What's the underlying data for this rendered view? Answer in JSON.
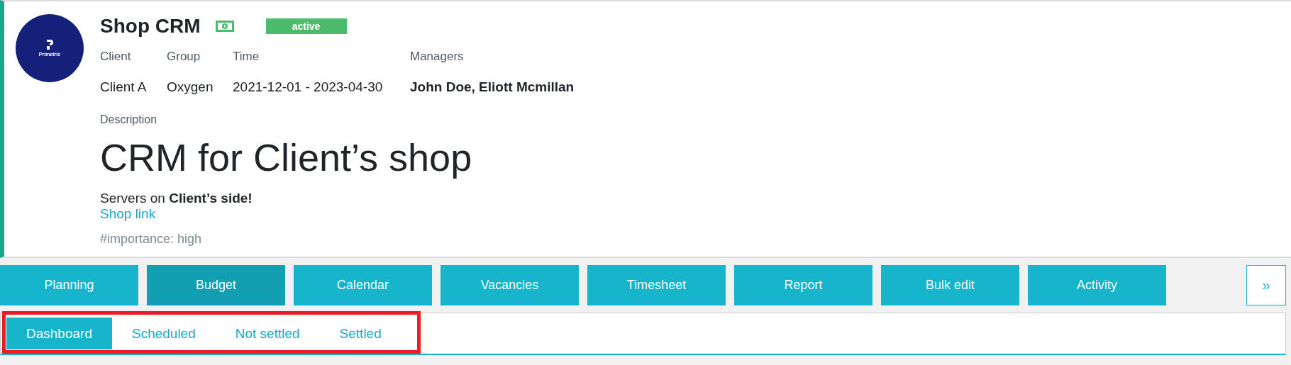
{
  "project": {
    "logo": {
      "name": "Primetric"
    },
    "title": "Shop CRM",
    "billable": true,
    "status": "active",
    "fields": [
      {
        "label": "Client",
        "value": "Client A",
        "bold": false
      },
      {
        "label": "Group",
        "value": "Oxygen",
        "bold": false
      },
      {
        "label": "Time",
        "value": "2021-12-01 - 2023-04-30",
        "bold": false
      },
      {
        "label": "Managers",
        "value": "John Doe, Eliott Mcmillan",
        "bold": true
      }
    ],
    "description": {
      "label": "Description",
      "heading": "CRM for Client’s shop",
      "text": "Servers on **Client’s side!**",
      "link": "Shop link",
      "tag": "#importance: high"
    }
  },
  "nav_tabs": [
    {
      "label": "Planning",
      "selected": false
    },
    {
      "label": "Budget",
      "selected": true
    },
    {
      "label": "Calendar",
      "selected": false
    },
    {
      "label": "Vacancies",
      "selected": false
    },
    {
      "label": "Timesheet",
      "selected": false
    },
    {
      "label": "Report",
      "selected": false
    },
    {
      "label": "Bulk edit",
      "selected": false
    },
    {
      "label": "Activity",
      "selected": false
    }
  ],
  "more_button": "»",
  "sub_tabs": [
    {
      "label": "Dashboard",
      "selected": true
    },
    {
      "label": "Scheduled",
      "selected": false
    },
    {
      "label": "Not settled",
      "selected": false
    },
    {
      "label": "Settled",
      "selected": false
    }
  ]
}
